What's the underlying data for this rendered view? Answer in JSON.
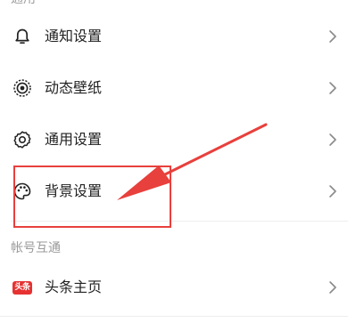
{
  "sections": {
    "general_header": "通用",
    "account_header": "帐号互通"
  },
  "rows": {
    "notification": {
      "label": "通知设置",
      "icon": "bell-icon"
    },
    "dynamic_wallpaper": {
      "label": "动态壁纸",
      "icon": "target-icon"
    },
    "general": {
      "label": "通用设置",
      "icon": "gear-icon"
    },
    "background": {
      "label": "背景设置",
      "icon": "palette-icon"
    },
    "toutiao": {
      "label": "头条主页",
      "icon": "toutiao-badge-icon",
      "badge_text": "头条"
    }
  },
  "annotation": {
    "highlight_color": "#e8403c",
    "target": "背景设置"
  },
  "colors": {
    "text": "#222222",
    "secondary_text": "#9a9a9a",
    "divider": "#eeeeee",
    "badge": "#e63232",
    "chevron": "#8a8a8a"
  }
}
